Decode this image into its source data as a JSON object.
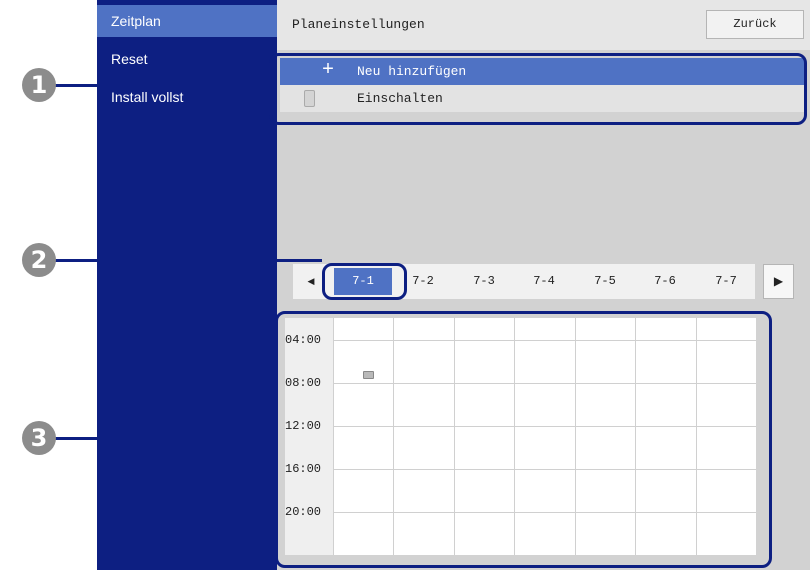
{
  "sidebar": {
    "items": [
      {
        "label": "Zeitplan",
        "active": true
      },
      {
        "label": "Reset",
        "active": false
      },
      {
        "label": "Install vollst",
        "active": false
      }
    ]
  },
  "header": {
    "title": "Planeinstellungen",
    "back_label": "Zurück"
  },
  "list": {
    "add_icon": "+",
    "add_label": "Neu hinzufügen",
    "power_label": "Einschalten"
  },
  "day_tabs": {
    "prev_icon": "◀",
    "next_icon": "▶",
    "tabs": [
      "7-1",
      "7-2",
      "7-3",
      "7-4",
      "7-5",
      "7-6",
      "7-7"
    ],
    "active_index": 0
  },
  "calendar": {
    "times": [
      "04:00",
      "08:00",
      "12:00",
      "16:00",
      "20:00"
    ]
  },
  "callouts": [
    "1",
    "2",
    "3"
  ],
  "colors": {
    "sidebar_bg": "#0d1f82",
    "accent": "#4f72c4",
    "callout_bg": "#8c8c8c"
  }
}
